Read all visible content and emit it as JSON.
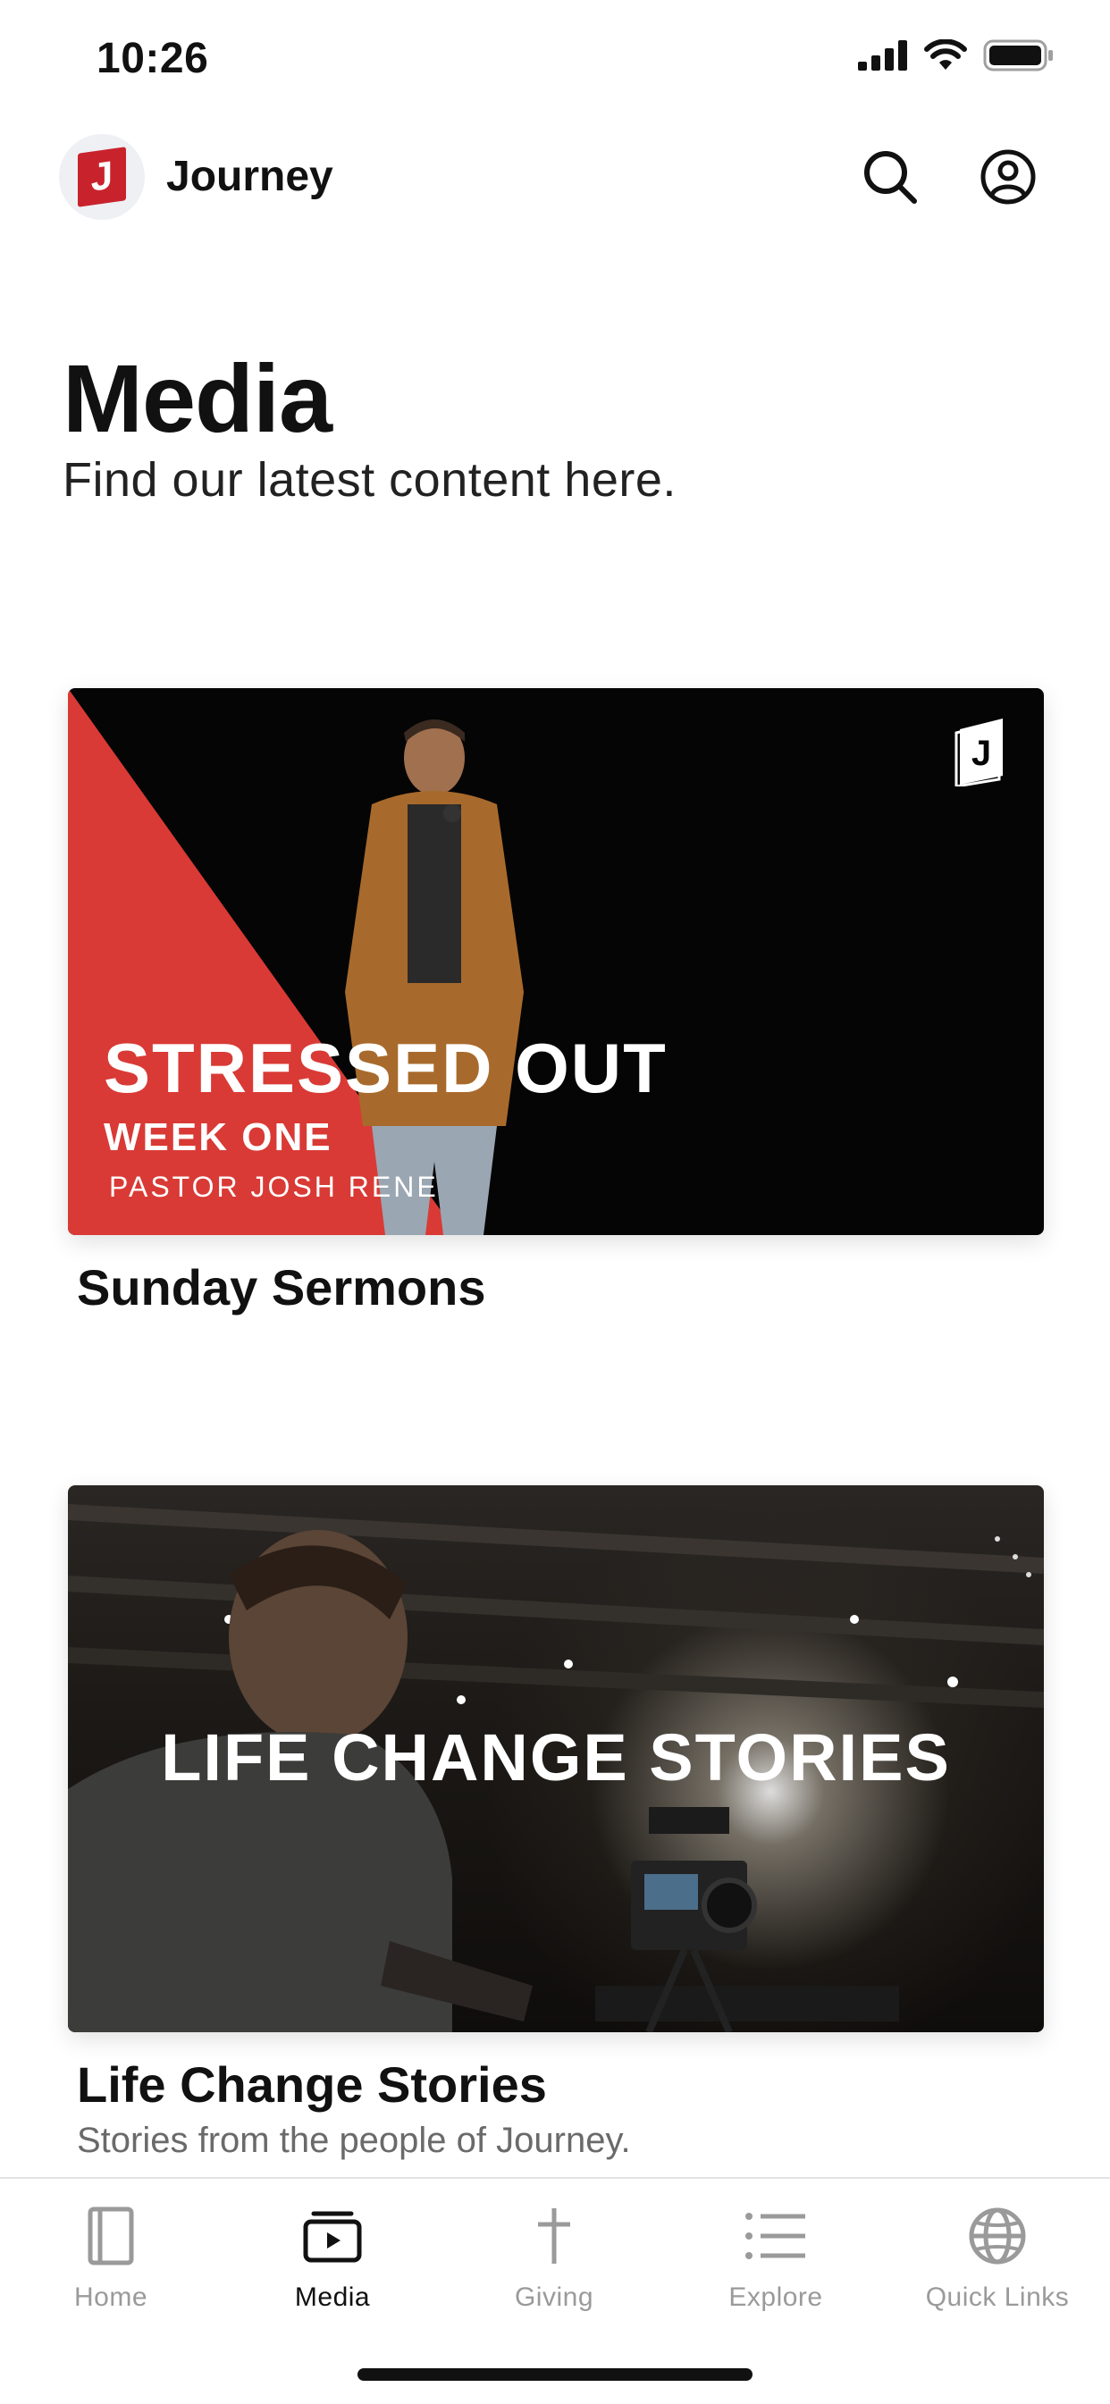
{
  "status_bar": {
    "time": "10:26"
  },
  "header": {
    "app_name": "Journey",
    "logo_letter": "J"
  },
  "page": {
    "title": "Media",
    "subtitle": "Find our latest content here."
  },
  "cards": [
    {
      "label": "Sunday Sermons",
      "thumb": {
        "title": "STRESSED OUT",
        "subtitle": "WEEK ONE",
        "speaker": "PASTOR JOSH RENE",
        "badge": "J",
        "accent": "#d93a35"
      }
    },
    {
      "label": "Life Change Stories",
      "description": "Stories from the people of Journey.",
      "thumb": {
        "title": "LIFE CHANGE STORIES"
      }
    }
  ],
  "tabs": [
    {
      "label": "Home",
      "icon": "home-icon",
      "active": false
    },
    {
      "label": "Media",
      "icon": "media-icon",
      "active": true
    },
    {
      "label": "Giving",
      "icon": "cross-icon",
      "active": false
    },
    {
      "label": "Explore",
      "icon": "list-icon",
      "active": false
    },
    {
      "label": "Quick Links",
      "icon": "globe-icon",
      "active": false
    }
  ],
  "colors": {
    "brand": "#c8232c",
    "tab_inactive": "#9a9a9a",
    "tab_active": "#111111"
  }
}
